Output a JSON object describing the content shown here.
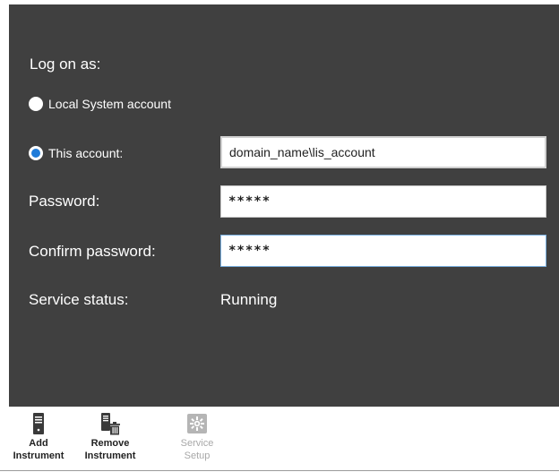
{
  "logon": {
    "heading": "Log on as:",
    "options": [
      {
        "label": "Local System account",
        "selected": false
      },
      {
        "label": "This account:",
        "selected": true
      }
    ],
    "account_value": "domain_name\\lis_account",
    "password_label": "Password:",
    "password_value": "*****",
    "confirm_label": "Confirm password:",
    "confirm_value": "*****",
    "status_label": "Service status:",
    "status_value": "Running"
  },
  "toolbar": {
    "add": {
      "line1": "Add",
      "line2": "Instrument",
      "icon": "server-icon"
    },
    "remove": {
      "line1": "Remove",
      "line2": "Instrument",
      "icon": "server-delete-icon"
    },
    "service": {
      "line1": "Service",
      "line2": "Setup",
      "icon": "service-gear-icon",
      "enabled": false
    }
  },
  "colors": {
    "panel": "#404040",
    "radio_accent": "#1e7bd9",
    "disabled_text": "#a8a8a8"
  }
}
